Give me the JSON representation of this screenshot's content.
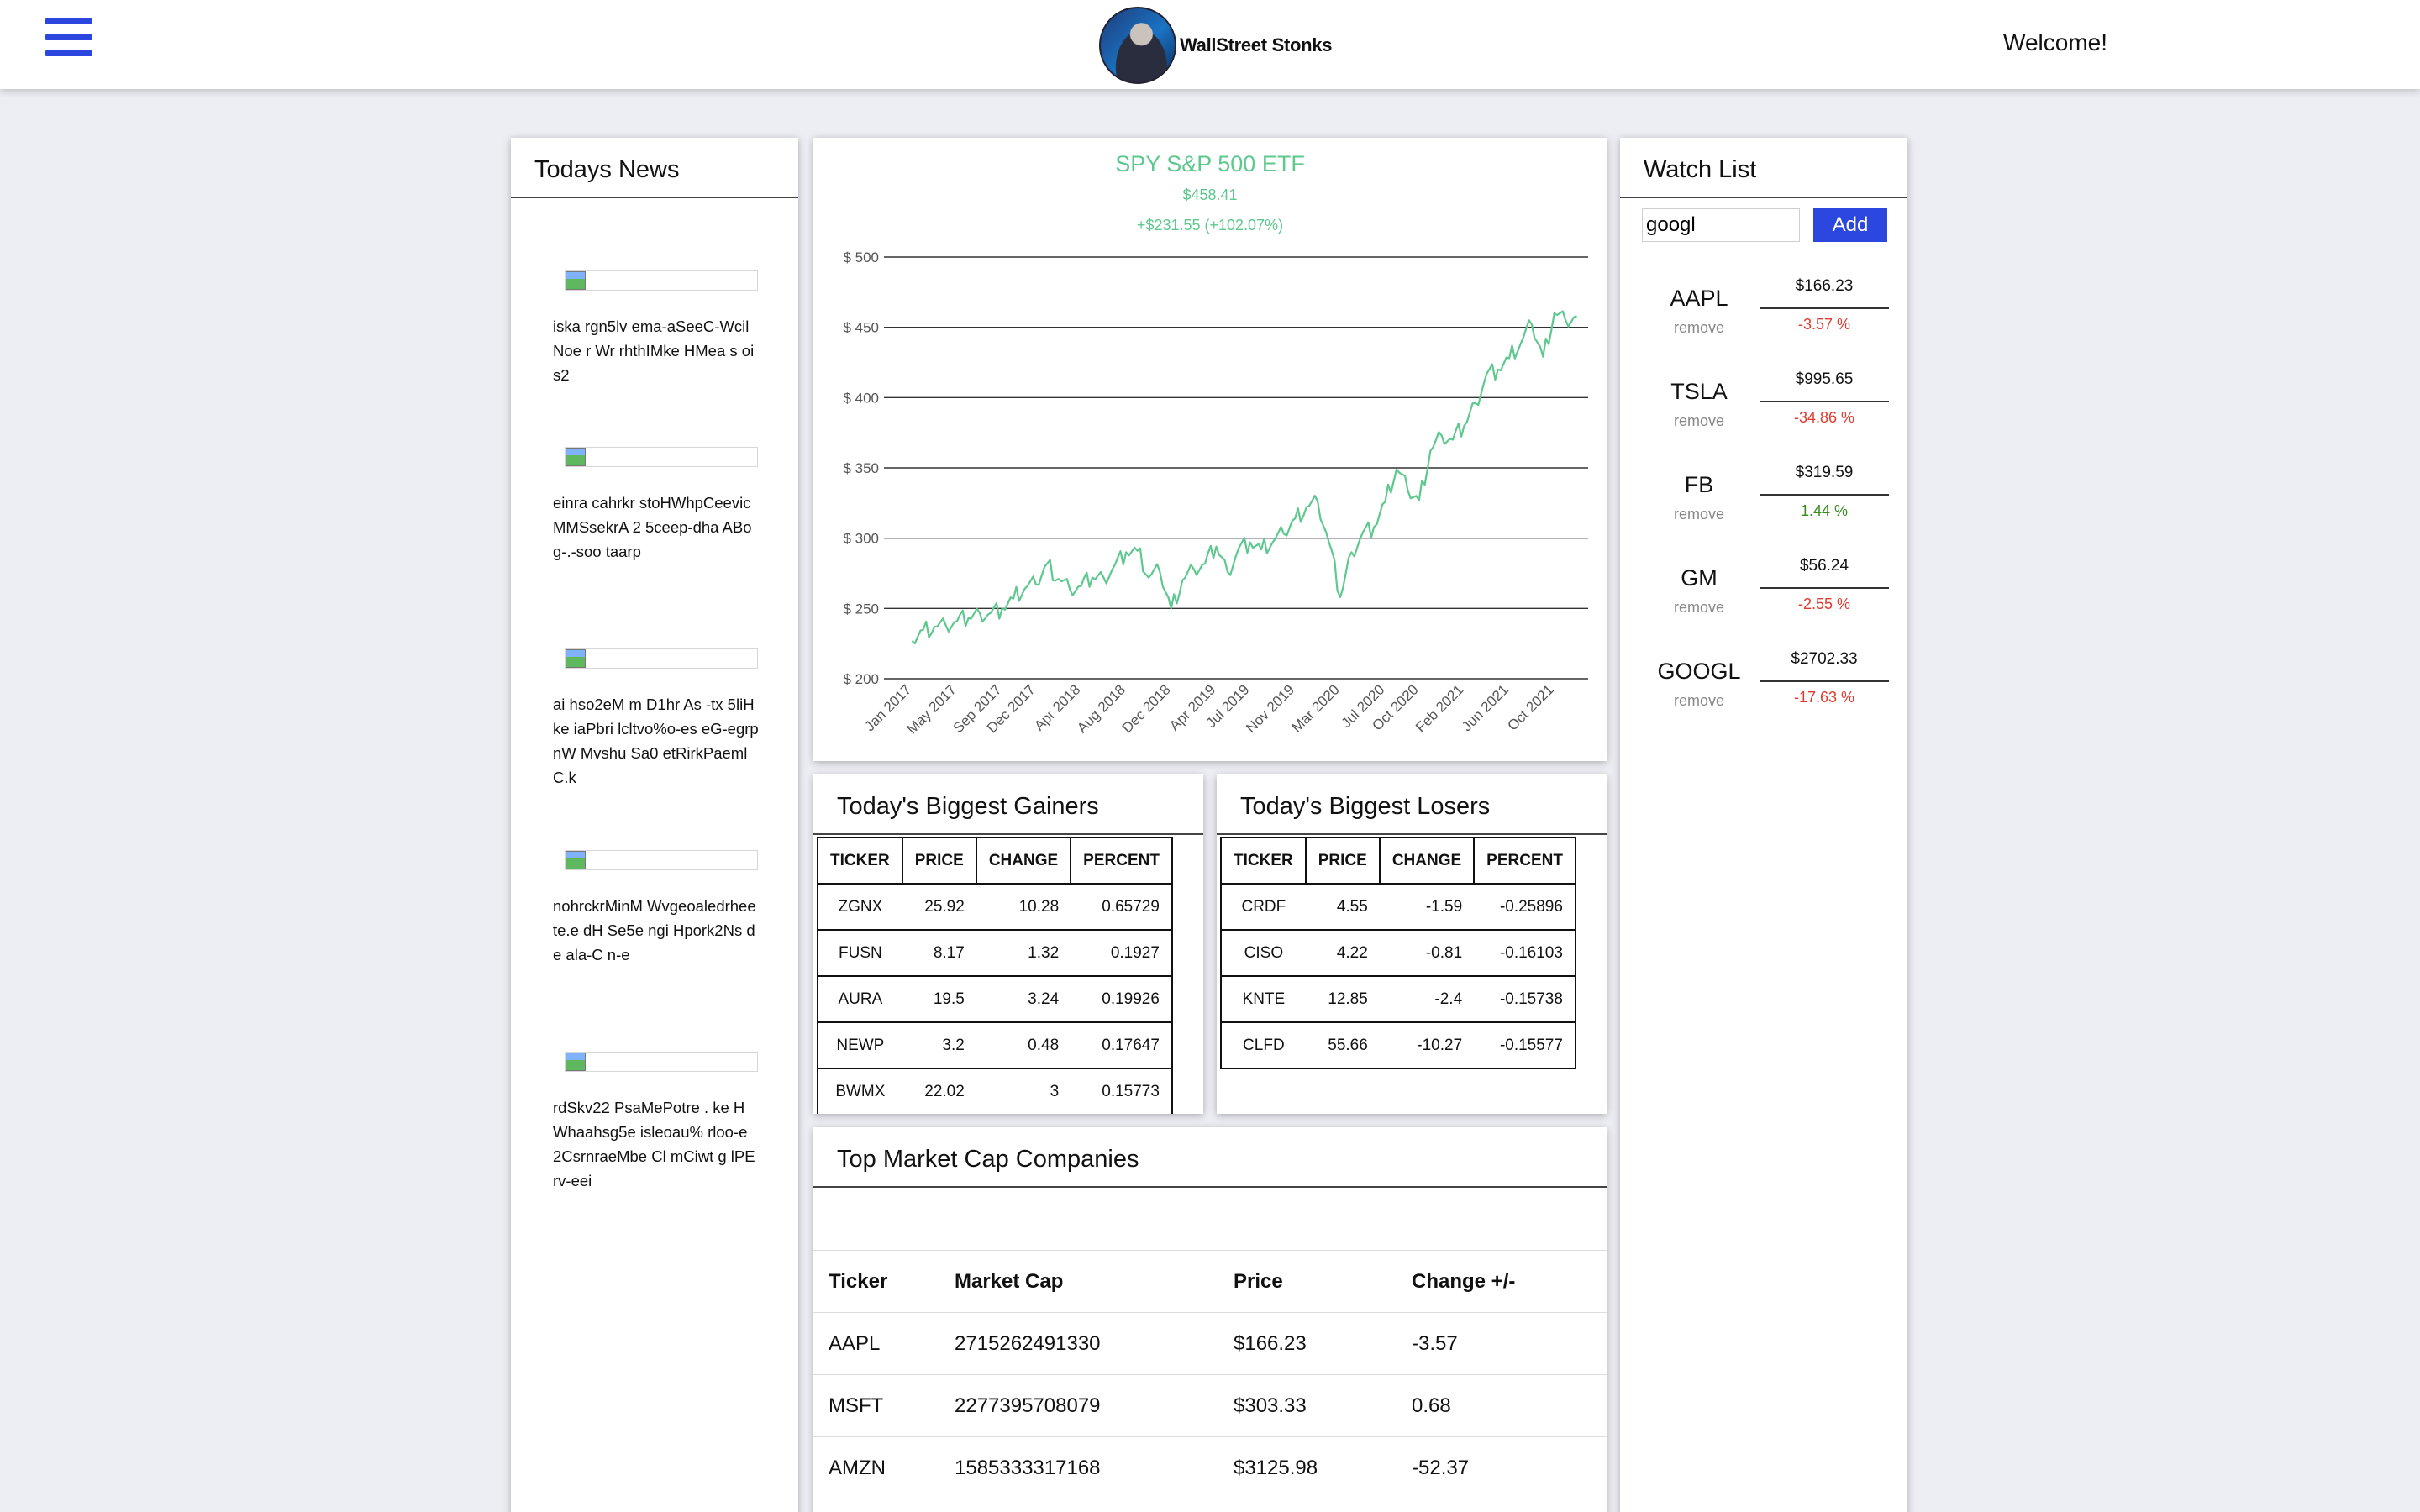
{
  "header": {
    "brand": "WallStreet Stonks",
    "welcome": "Welcome!"
  },
  "news": {
    "title": "Todays News",
    "items": [
      {
        "text": "iska rgn5lv ema-aSeeC-WcilNoe r Wr rhthIMke HMea s ois2"
      },
      {
        "text": "einra cahrkr stoHWhpCeevicMMSsekrA 2 5ceep-dha ABog-.-soo taarp"
      },
      {
        "text": "ai hso2eM m D1hr As -tx 5liHke iaPbri lcltvo%o-es eG-egrpnW Mvshu Sa0 etRirkPaemlC.k"
      },
      {
        "text": "nohrckrMinM Wvgeoaledrheete.e dH Se5e ngi Hpork2Ns de ala-C n-e"
      },
      {
        "text": "rdSkv22 PsaMePotre . ke H Whaahsg5e isleoau% rloo-e 2CsrnraeMbe Cl mCiwt g lPErv-eei"
      }
    ]
  },
  "spy": {
    "title": "SPY S&P 500 ETF",
    "price": "$458.41",
    "change": "+$231.55 (+102.07%)",
    "line_color": "#5ec88e"
  },
  "chart_data": {
    "type": "line",
    "title": "SPY S&P 500 ETF",
    "ylim": [
      200,
      500
    ],
    "y_ticks": [
      "$ 500",
      "$ 450",
      "$ 400",
      "$ 350",
      "$ 300",
      "$ 250",
      "$ 200"
    ],
    "y_tick_values": [
      500,
      450,
      400,
      350,
      300,
      250,
      200
    ],
    "x_tick_labels": [
      "Jan 2017",
      "May 2017",
      "Sep 2017",
      "Dec 2017",
      "Apr 2018",
      "Aug 2018",
      "Dec 2018",
      "Apr 2019",
      "Jul 2019",
      "Nov 2019",
      "Mar 2020",
      "Jul 2020",
      "Oct 2020",
      "Feb 2021",
      "Jun 2021",
      "Oct 2021"
    ],
    "x_tick_positions": [
      0,
      4,
      8,
      11,
      15,
      19,
      23,
      27,
      30,
      34,
      38,
      42,
      45,
      49,
      53,
      57
    ],
    "x_range": [
      -1,
      60
    ],
    "x_values": [
      "2017-01",
      "2017-02",
      "2017-03",
      "2017-04",
      "2017-05",
      "2017-06",
      "2017-07",
      "2017-08",
      "2017-09",
      "2017-10",
      "2017-11",
      "2017-12",
      "2018-01",
      "2018-02",
      "2018-03",
      "2018-04",
      "2018-05",
      "2018-06",
      "2018-07",
      "2018-08",
      "2018-09",
      "2018-10",
      "2018-11",
      "2018-12",
      "2019-01",
      "2019-02",
      "2019-03",
      "2019-04",
      "2019-05",
      "2019-06",
      "2019-07",
      "2019-08",
      "2019-09",
      "2019-10",
      "2019-11",
      "2019-12",
      "2020-01",
      "2020-02",
      "2020-03",
      "2020-04",
      "2020-05",
      "2020-06",
      "2020-07",
      "2020-08",
      "2020-09",
      "2020-10",
      "2020-11",
      "2020-12",
      "2021-01",
      "2021-02",
      "2021-03",
      "2021-04",
      "2021-05",
      "2021-06",
      "2021-07",
      "2021-08",
      "2021-09",
      "2021-10",
      "2021-11",
      "2021-12"
    ],
    "series": [
      {
        "values": [
          227,
          235,
          237,
          238,
          241,
          243,
          247,
          247,
          250,
          257,
          264,
          267,
          282,
          271,
          264,
          266,
          272,
          272,
          281,
          290,
          291,
          272,
          276,
          250,
          270,
          278,
          282,
          294,
          276,
          293,
          297,
          292,
          297,
          303,
          314,
          322,
          326,
          297,
          258,
          290,
          304,
          308,
          326,
          349,
          334,
          327,
          362,
          373,
          370,
          380,
          396,
          417,
          420,
          428,
          438,
          452,
          429,
          460,
          455,
          458
        ]
      }
    ]
  },
  "gainers": {
    "title": "Today's Biggest Gainers",
    "headers": [
      "TICKER",
      "PRICE",
      "CHANGE",
      "PERCENT"
    ],
    "rows": [
      [
        "ZGNX",
        "25.92",
        "10.28",
        "0.65729"
      ],
      [
        "FUSN",
        "8.17",
        "1.32",
        "0.1927"
      ],
      [
        "AURA",
        "19.5",
        "3.24",
        "0.19926"
      ],
      [
        "NEWP",
        "3.2",
        "0.48",
        "0.17647"
      ],
      [
        "BWMX",
        "22.02",
        "3",
        "0.15773"
      ]
    ]
  },
  "losers": {
    "title": "Today's Biggest Losers",
    "headers": [
      "TICKER",
      "PRICE",
      "CHANGE",
      "PERCENT"
    ],
    "rows": [
      [
        "CRDF",
        "4.55",
        "-1.59",
        "-0.25896"
      ],
      [
        "CISO",
        "4.22",
        "-0.81",
        "-0.16103"
      ],
      [
        "KNTE",
        "12.85",
        "-2.4",
        "-0.15738"
      ],
      [
        "CLFD",
        "55.66",
        "-10.27",
        "-0.15577"
      ]
    ]
  },
  "topcap": {
    "title": "Top Market Cap Companies",
    "headers": [
      "Ticker",
      "Market Cap",
      "Price",
      "Change +/-"
    ],
    "rows": [
      [
        "AAPL",
        "2715262491330",
        "$166.23",
        "-3.57"
      ],
      [
        "MSFT",
        "2277395708079",
        "$303.33",
        "0.68"
      ],
      [
        "AMZN",
        "1585333317168",
        "$3125.98",
        "-52.37"
      ]
    ]
  },
  "watchlist": {
    "title": "Watch List",
    "input_value": "googl",
    "add_label": "Add",
    "remove_label": "remove",
    "up_color": "#3a8a1f",
    "down_color": "#e03a2e",
    "items": [
      {
        "ticker": "AAPL",
        "price": "$166.23",
        "pct": "-3.57 %",
        "dir": "down"
      },
      {
        "ticker": "TSLA",
        "price": "$995.65",
        "pct": "-34.86 %",
        "dir": "down"
      },
      {
        "ticker": "FB",
        "price": "$319.59",
        "pct": "1.44 %",
        "dir": "up"
      },
      {
        "ticker": "GM",
        "price": "$56.24",
        "pct": "-2.55 %",
        "dir": "down"
      },
      {
        "ticker": "GOOGL",
        "price": "$2702.33",
        "pct": "-17.63 %",
        "dir": "down"
      }
    ]
  }
}
